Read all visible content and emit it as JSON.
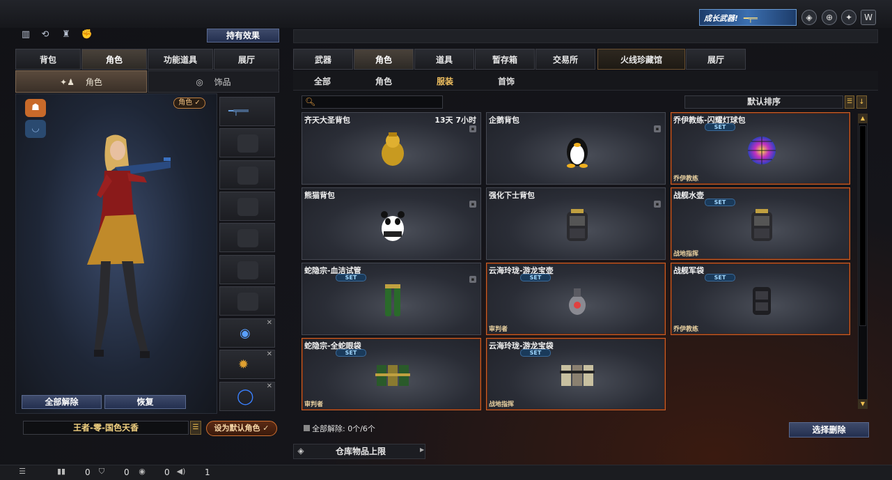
{
  "header": {
    "promo_label": "成长武器!",
    "icons": [
      "shield-badge-icon",
      "target-icon",
      "claw-badge-icon",
      "wing-logo-icon"
    ]
  },
  "left": {
    "effect_button": "持有效果",
    "top_icons": [
      "rank-icon",
      "rotate-icon",
      "run-icon",
      "fist-icon"
    ],
    "tabs": [
      {
        "label": "背包",
        "active": false
      },
      {
        "label": "角色",
        "active": true
      },
      {
        "label": "功能道具",
        "active": false
      },
      {
        "label": "展厅",
        "active": false
      }
    ],
    "subtabs": {
      "role": "角色",
      "accessory": "饰品"
    },
    "role_badge": "角色 ✓",
    "unequip_all": "全部解除",
    "restore": "恢复",
    "role_name": "王者-零-国色天香",
    "set_default": "设为默认角色 ✓"
  },
  "right": {
    "tabs": [
      {
        "label": "武器",
        "active": false
      },
      {
        "label": "角色",
        "active": true
      },
      {
        "label": "道具",
        "active": false
      },
      {
        "label": "暂存箱",
        "active": false
      },
      {
        "label": "交易所",
        "active": false
      },
      {
        "label": "火线珍藏馆",
        "active": false
      },
      {
        "label": "展厅",
        "active": false
      }
    ],
    "subtabs": [
      {
        "label": "全部",
        "active": false
      },
      {
        "label": "角色",
        "active": false
      },
      {
        "label": "服装",
        "active": true
      },
      {
        "label": "首饰",
        "active": false
      }
    ],
    "search_icon": "search-icon",
    "sort_label": "默认排序",
    "items": [
      {
        "name": "齐天大圣背包",
        "time": "13天 7小时",
        "lock": true,
        "set": false,
        "tag": "",
        "orange": false,
        "art": "monkey"
      },
      {
        "name": "企鹅背包",
        "time": "",
        "lock": true,
        "set": false,
        "tag": "",
        "orange": false,
        "art": "penguin"
      },
      {
        "name": "乔伊教练-闪耀灯球包",
        "time": "",
        "lock": false,
        "set": true,
        "tag": "乔伊教练",
        "orange": true,
        "art": "discoball"
      },
      {
        "name": "熊猫背包",
        "time": "",
        "lock": true,
        "set": false,
        "tag": "",
        "orange": false,
        "art": "panda"
      },
      {
        "name": "强化下士背包",
        "time": "",
        "lock": true,
        "set": false,
        "tag": "",
        "orange": false,
        "art": "backpack"
      },
      {
        "name": "战舰水壶",
        "time": "",
        "lock": false,
        "set": true,
        "tag": "战地指挥",
        "orange": true,
        "art": "backpack"
      },
      {
        "name": "蛇隐宗-血洁试管",
        "time": "",
        "lock": true,
        "set": true,
        "tag": "",
        "orange": false,
        "art": "tubes"
      },
      {
        "name": "云海玲珑-游龙宝壶",
        "time": "",
        "lock": false,
        "set": true,
        "tag": "审判者",
        "orange": true,
        "art": "flask"
      },
      {
        "name": "战舰军袋",
        "time": "",
        "lock": false,
        "set": true,
        "tag": "乔伊教练",
        "orange": true,
        "art": "pouch"
      },
      {
        "name": "蛇隐宗-全蛇眼袋",
        "time": "",
        "lock": false,
        "set": true,
        "tag": "审判者",
        "orange": true,
        "art": "belt"
      },
      {
        "name": "云海玲珑-游龙宝袋",
        "time": "",
        "lock": false,
        "set": true,
        "tag": "战地指挥",
        "orange": true,
        "art": "belt2"
      }
    ],
    "set_label": "SET",
    "unequip_status": "全部解除: 0个/6个",
    "select_delete": "选择删除",
    "storage_limit": "仓库物品上限"
  },
  "status": {
    "count1": "0",
    "count2": "0",
    "count3": "0",
    "count4": "1"
  },
  "colors": {
    "accent": "#f0c060",
    "orange_border": "#c8602a",
    "set_blue": "#a0d8ff"
  }
}
